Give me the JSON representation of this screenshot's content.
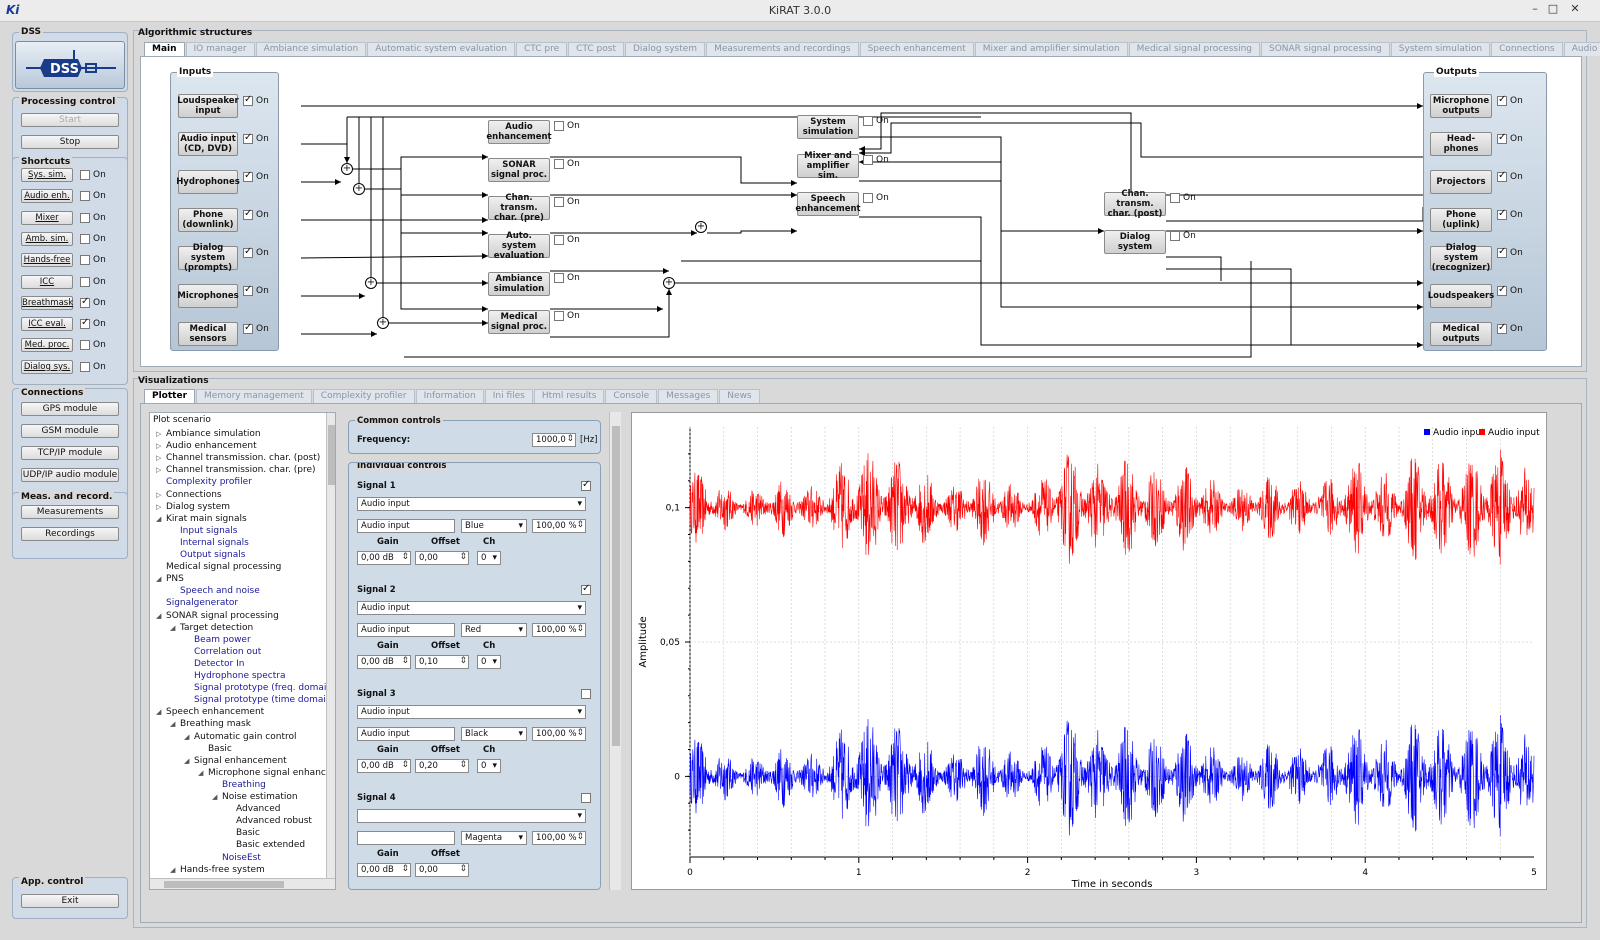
{
  "window": {
    "icon_text": "Ki",
    "title": "KiRAT 3.0.0",
    "controls": [
      "–",
      "□",
      "✕"
    ]
  },
  "dss": {
    "title": "DSS",
    "logo_text": "DSS"
  },
  "processing": {
    "title": "Processing control",
    "start": "Start",
    "stop": "Stop"
  },
  "shortcuts": {
    "title": "Shortcuts",
    "on_label": "On",
    "items": [
      {
        "label": "Sys. sim.",
        "checked": false
      },
      {
        "label": "Audio enh.",
        "checked": false
      },
      {
        "label": "Mixer",
        "checked": false
      },
      {
        "label": "Amb. sim.",
        "checked": false
      },
      {
        "label": "Hands-free",
        "checked": false
      },
      {
        "label": "ICC",
        "checked": false
      },
      {
        "label": "Breathmask",
        "checked": true
      },
      {
        "label": "ICC eval.",
        "checked": true
      },
      {
        "label": "Med. proc.",
        "checked": false
      },
      {
        "label": "Dialog sys.",
        "checked": false
      }
    ]
  },
  "connections": {
    "title": "Connections",
    "items": [
      "GPS module",
      "GSM module",
      "TCP/IP module",
      "UDP/IP audio module"
    ]
  },
  "meas": {
    "title": "Meas. and record.",
    "items": [
      "Measurements",
      "Recordings"
    ]
  },
  "app": {
    "title": "App. control",
    "exit": "Exit"
  },
  "algo": {
    "title": "Algorithmic structures",
    "tabs": [
      "Main",
      "IO manager",
      "Ambiance simulation",
      "Automatic system evaluation",
      "CTC pre",
      "CTC post",
      "Dialog system",
      "Measurements and recordings",
      "Speech enhancement",
      "Mixer and amplifier simulation",
      "Medical signal processing",
      "SONAR signal processing",
      "System simulation",
      "Connections",
      "Audio enhancement"
    ],
    "inputs_title": "Inputs",
    "outputs_title": "Outputs",
    "on_label": "On",
    "inputs": [
      "Loudspeaker input",
      "Audio input (CD, DVD)",
      "Hydrophones",
      "Phone (downlink)",
      "Dialog system (prompts)",
      "Microphones",
      "Medical sensors"
    ],
    "outputs": [
      "Microphone outputs",
      "Head-phones",
      "Projectors",
      "Phone (uplink)",
      "Dialog system (recognizer)",
      "Loudspeakers",
      "Medical outputs"
    ],
    "blocks": [
      "Audio enhancement",
      "SONAR signal proc.",
      "Chan. transm. char. (pre)",
      "Auto. system evaluation",
      "Ambiance simulation",
      "Medical signal proc.",
      "System simulation",
      "Mixer and amplifier sim.",
      "Speech enhancement",
      "Chan. transm. char. (post)",
      "Dialog system"
    ]
  },
  "viz": {
    "title": "Visualizations",
    "tabs": [
      "Plotter",
      "Memory management",
      "Complexity profiler",
      "Information",
      "Ini files",
      "Html results",
      "Console",
      "Messages",
      "News"
    ]
  },
  "tree": {
    "header": "Plot scenario",
    "items": [
      {
        "label": "Ambiance simulation",
        "level": 0,
        "arrow": "▷",
        "blue": false
      },
      {
        "label": "Audio enhancement",
        "level": 0,
        "arrow": "▷",
        "blue": false
      },
      {
        "label": "Channel transmission. char. (post)",
        "level": 0,
        "arrow": "▷",
        "blue": false
      },
      {
        "label": "Channel transmission. char. (pre)",
        "level": 0,
        "arrow": "▷",
        "blue": false
      },
      {
        "label": "Complexity profiler",
        "level": 0,
        "arrow": "",
        "blue": true
      },
      {
        "label": "Connections",
        "level": 0,
        "arrow": "▷",
        "blue": false
      },
      {
        "label": "Dialog system",
        "level": 0,
        "arrow": "▷",
        "blue": false
      },
      {
        "label": "Kirat main signals",
        "level": 0,
        "arrow": "◢",
        "blue": false
      },
      {
        "label": "Input signals",
        "level": 1,
        "arrow": "",
        "blue": true
      },
      {
        "label": "Internal signals",
        "level": 1,
        "arrow": "",
        "blue": true
      },
      {
        "label": "Output signals",
        "level": 1,
        "arrow": "",
        "blue": true
      },
      {
        "label": "Medical signal processing",
        "level": 0,
        "arrow": "",
        "blue": false
      },
      {
        "label": "PNS",
        "level": 0,
        "arrow": "◢",
        "blue": false
      },
      {
        "label": "Speech and noise",
        "level": 1,
        "arrow": "",
        "blue": true
      },
      {
        "label": "Signalgenerator",
        "level": 0,
        "arrow": "",
        "blue": true
      },
      {
        "label": "SONAR signal processing",
        "level": 0,
        "arrow": "◢",
        "blue": false
      },
      {
        "label": "Target detection",
        "level": 1,
        "arrow": "◢",
        "blue": false
      },
      {
        "label": "Beam power",
        "level": 2,
        "arrow": "",
        "blue": true
      },
      {
        "label": "Correlation out",
        "level": 2,
        "arrow": "",
        "blue": true
      },
      {
        "label": "Detector In",
        "level": 2,
        "arrow": "",
        "blue": true
      },
      {
        "label": "Hydrophone spectra",
        "level": 2,
        "arrow": "",
        "blue": true
      },
      {
        "label": "Signal prototype (freq. domain)",
        "level": 2,
        "arrow": "",
        "blue": true
      },
      {
        "label": "Signal prototype (time domain)",
        "level": 2,
        "arrow": "",
        "blue": true
      },
      {
        "label": "Speech enhancement",
        "level": 0,
        "arrow": "◢",
        "blue": false
      },
      {
        "label": "Breathing mask",
        "level": 1,
        "arrow": "◢",
        "blue": false
      },
      {
        "label": "Automatic gain control",
        "level": 2,
        "arrow": "◢",
        "blue": false
      },
      {
        "label": "Basic",
        "level": 3,
        "arrow": "",
        "blue": false
      },
      {
        "label": "Signal enhancement",
        "level": 2,
        "arrow": "◢",
        "blue": false
      },
      {
        "label": "Microphone signal enhanceme",
        "level": 3,
        "arrow": "◢",
        "blue": false
      },
      {
        "label": "Breathing",
        "level": 4,
        "arrow": "",
        "blue": true
      },
      {
        "label": "Noise estimation",
        "level": 4,
        "arrow": "◢",
        "blue": false
      },
      {
        "label": "Advanced",
        "level": 5,
        "arrow": "",
        "blue": false
      },
      {
        "label": "Advanced robust",
        "level": 5,
        "arrow": "",
        "blue": false
      },
      {
        "label": "Basic",
        "level": 5,
        "arrow": "",
        "blue": false
      },
      {
        "label": "Basic extended",
        "level": 5,
        "arrow": "",
        "blue": false
      },
      {
        "label": "NoiseEst",
        "level": 4,
        "arrow": "",
        "blue": true
      },
      {
        "label": "Hands-free system",
        "level": 1,
        "arrow": "◢",
        "blue": false
      }
    ]
  },
  "common": {
    "title": "Common controls",
    "freq_label": "Frequency:",
    "freq_value": "1000,0",
    "freq_unit": "[Hz]"
  },
  "individual": {
    "title": "Individual controls",
    "gain_label": "Gain",
    "offset_label": "Offset",
    "ch_label": "Ch",
    "signals": [
      {
        "name": "Signal 1",
        "checked": true,
        "source": "Audio input",
        "label": "Audio input",
        "color": "Blue",
        "scale": "100,00 %",
        "gain": "0,00 dB",
        "offset": "0,00",
        "ch": "0"
      },
      {
        "name": "Signal 2",
        "checked": true,
        "source": "Audio input",
        "label": "Audio input",
        "color": "Red",
        "scale": "100,00 %",
        "gain": "0,00 dB",
        "offset": "0,10",
        "ch": "0"
      },
      {
        "name": "Signal 3",
        "checked": false,
        "source": "Audio input",
        "label": "Audio input",
        "color": "Black",
        "scale": "100,00 %",
        "gain": "0,00 dB",
        "offset": "0,20",
        "ch": "0"
      },
      {
        "name": "Signal 4",
        "checked": false,
        "source": "",
        "label": "",
        "color": "Magenta",
        "scale": "100,00 %",
        "gain": "0,00 dB",
        "offset": "0,00",
        "ch": ""
      }
    ]
  },
  "chart_data": {
    "type": "line",
    "xlabel": "Time in seconds",
    "ylabel": "Amplitude",
    "xlim": [
      0,
      5
    ],
    "ylim": [
      -0.03,
      0.13
    ],
    "x_ticks": [
      "0",
      "1",
      "2",
      "3",
      "4",
      "5"
    ],
    "y_ticks": [
      "0",
      "0,05",
      "0,1"
    ],
    "y_tick_values": [
      0,
      0.05,
      0.1
    ],
    "grid": true,
    "legend_position": "top-right",
    "series": [
      {
        "name": "Audio input",
        "color": "#0000ff",
        "offset": 0.0
      },
      {
        "name": "Audio input",
        "color": "#ff0000",
        "offset": 0.1
      }
    ]
  }
}
